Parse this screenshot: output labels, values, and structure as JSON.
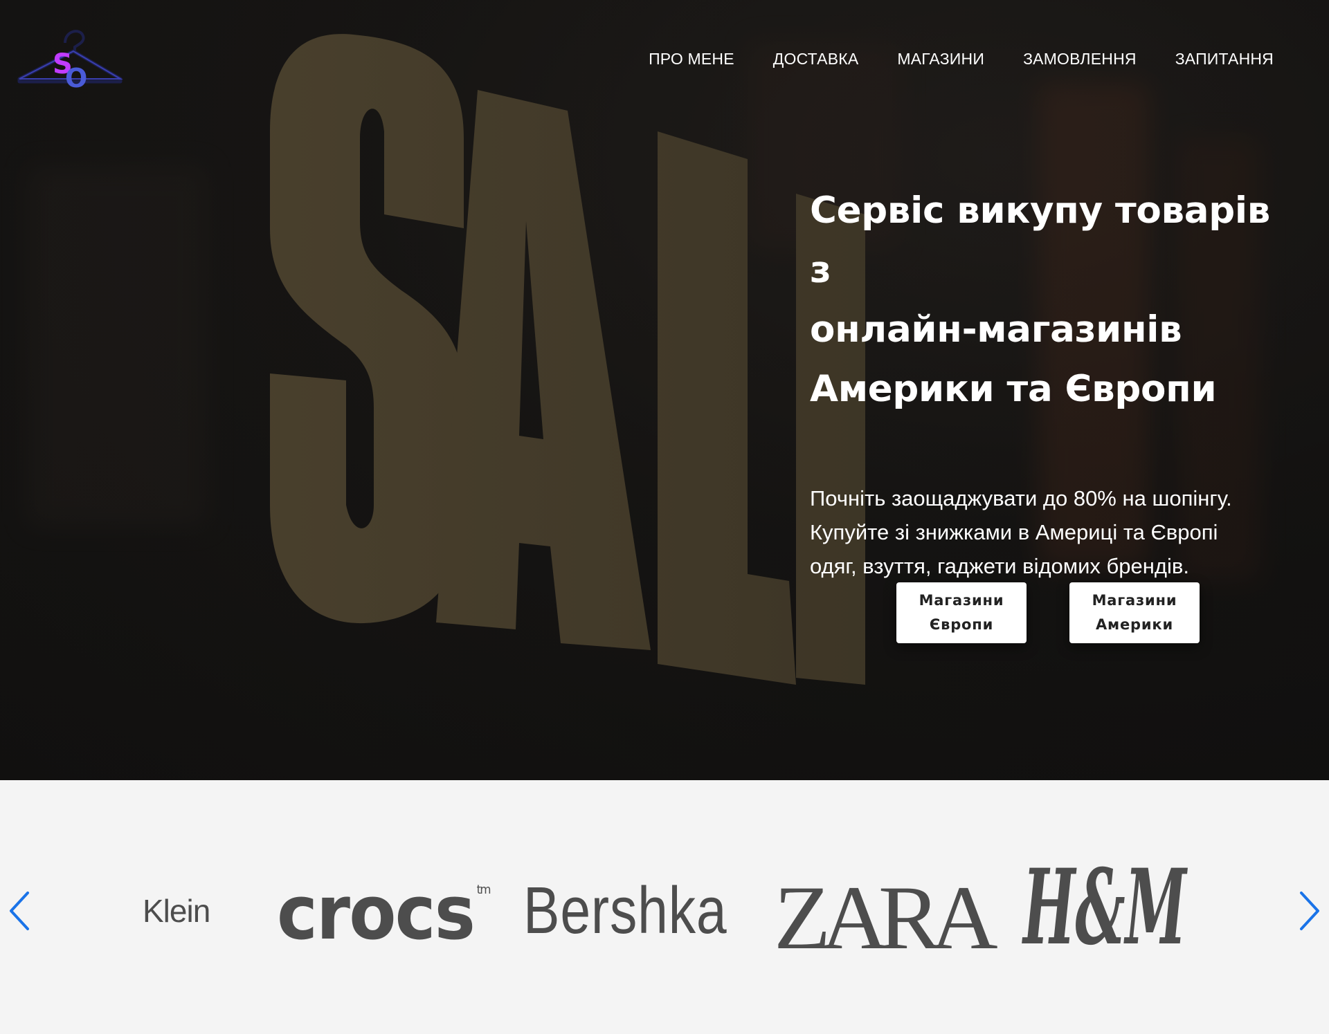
{
  "logo": {
    "letters": "SO"
  },
  "nav": {
    "items": [
      {
        "label": "ПРО МЕНЕ"
      },
      {
        "label": "ДОСТАВКА"
      },
      {
        "label": "МАГАЗИНИ"
      },
      {
        "label": "ЗАМОВЛЕННЯ"
      },
      {
        "label": "ЗАПИТАННЯ"
      }
    ]
  },
  "hero": {
    "background_text": "SALE",
    "title_lines": [
      "Сервіс викупу товарів з",
      "онлайн-магазинів",
      "Америки та Європи"
    ],
    "subtitle_lines": [
      "Почніть заощаджувати до 80% на шопінгу.",
      "Купуйте зі знижками в Америці та Європі",
      "одяг, взуття, гаджети відомих брендів."
    ],
    "buttons": [
      {
        "line1": "Магазини",
        "line2": "Європи"
      },
      {
        "line1": "Магазини",
        "line2": "Америки"
      }
    ]
  },
  "brands": {
    "items": [
      {
        "name": "Klein"
      },
      {
        "name": "crocs",
        "mark": "tm"
      },
      {
        "name": "Bershka"
      },
      {
        "name": "ZARA"
      },
      {
        "name": "H&M"
      }
    ],
    "prev_icon": "chevron-left-icon",
    "next_icon": "chevron-right-icon"
  },
  "colors": {
    "hero_bg": "#161412",
    "sale_letters": "#5a4e36",
    "brand_gray": "#4d4d4d",
    "arrow_blue": "#1a73e8",
    "logo_purple": "#c13cff",
    "logo_blue": "#4a5bd8",
    "logo_dark": "#1c1f4a"
  }
}
